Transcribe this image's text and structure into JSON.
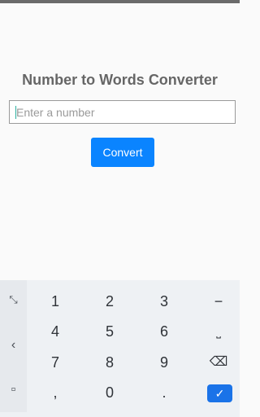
{
  "app": {
    "title": "Number to Words Converter",
    "input_placeholder": "Enter a number",
    "input_value": "",
    "convert_label": "Convert"
  },
  "keyboard": {
    "side_icons": [
      "expand-icon",
      "chevron-left-icon",
      "picture-in-picture-icon"
    ],
    "side_glyphs": [
      "⤡",
      "‹",
      "▫"
    ],
    "rows": [
      [
        "1",
        "2",
        "3",
        "−"
      ],
      [
        "4",
        "5",
        "6",
        "⎵"
      ],
      [
        "7",
        "8",
        "9",
        "⌫"
      ],
      [
        ",",
        "0",
        ".",
        "✓"
      ]
    ]
  },
  "colors": {
    "accent": "#0a84ff",
    "done_key": "#1a73e8",
    "title_text": "#666666"
  }
}
